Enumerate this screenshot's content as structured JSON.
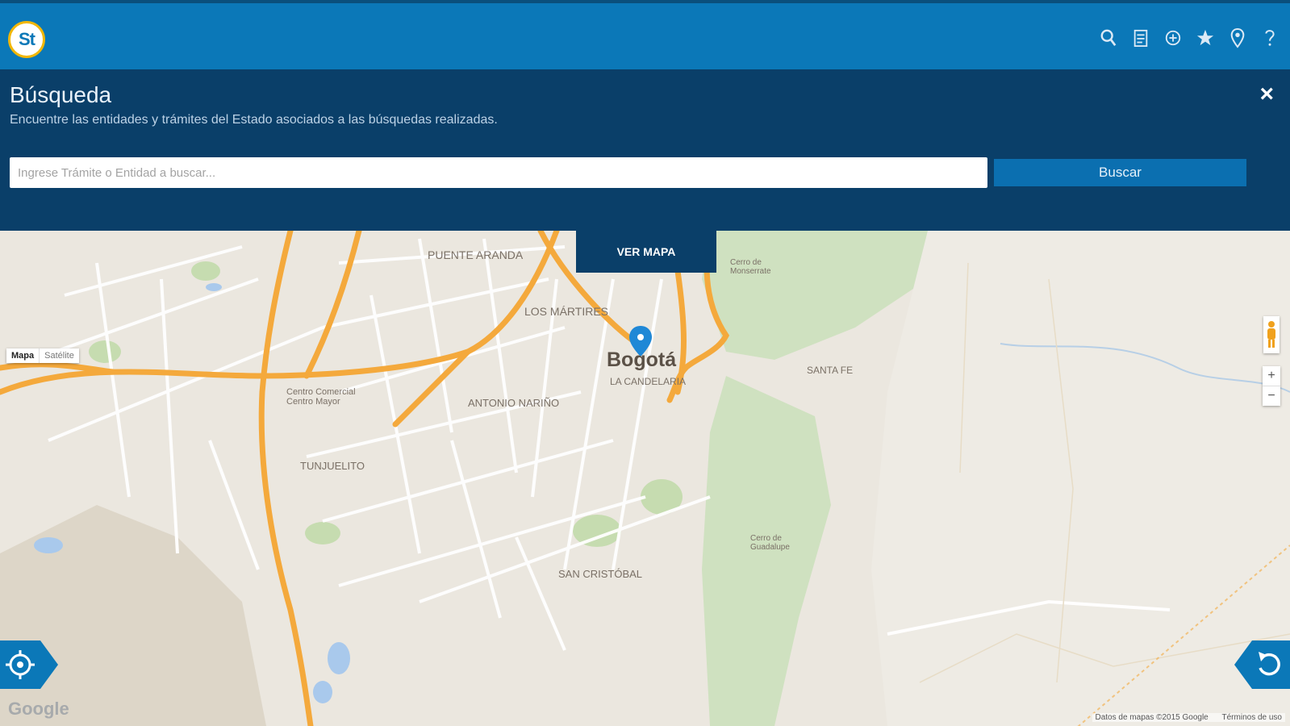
{
  "header": {
    "logo_text": "St",
    "icons": [
      "search-icon",
      "document-icon",
      "plus-icon",
      "star-icon",
      "location-pin-icon",
      "help-icon"
    ],
    "colors": {
      "bar": "#0b78b8",
      "panel": "#0a3f69",
      "accent": "#f2b705"
    }
  },
  "search_panel": {
    "title": "Búsqueda",
    "subtitle": "Encuentre las entidades y trámites del Estado asociados a las búsquedas realizadas.",
    "input_placeholder": "Ingrese Trámite o Entidad a buscar...",
    "button_label": "Buscar",
    "close_label": "×"
  },
  "map": {
    "toggle_label": "VER MAPA",
    "map_type": {
      "map": "Mapa",
      "satellite": "Satélite"
    },
    "city": "Bogotá",
    "places": [
      "PUENTE ARANDA",
      "LOS MÁRTIRES",
      "LA CANDELARIA",
      "ANTONIO NARIÑO",
      "TUNJUELITO",
      "SAN CRISTÓBAL",
      "SANTA FE",
      "Centro Comercial Centro Mayor",
      "Cerro de Monserrate",
      "Cerro de Guadalupe"
    ],
    "zoom": {
      "in": "+",
      "out": "−"
    },
    "google": "Google",
    "attribution": {
      "data": "Datos de mapas ©2015 Google",
      "terms": "Términos de uso"
    }
  }
}
